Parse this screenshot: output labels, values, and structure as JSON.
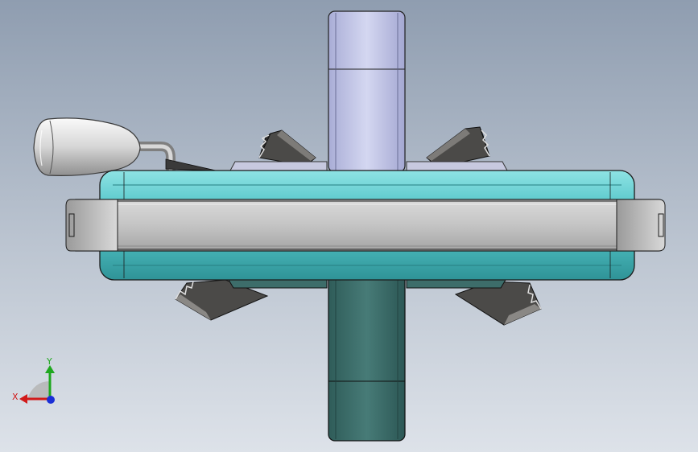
{
  "view": {
    "background_top": "#8f9db0",
    "background_bottom": "#dde2e9"
  },
  "model": {
    "upper_post_color": "#c3c6e6",
    "lower_post_color": "#3b6b68",
    "ring_color": "#5cc9cc",
    "band_color": "#bdbdbd",
    "jaw_color": "#4b4a48",
    "handle_color": "#e6e6e6"
  },
  "triad": {
    "x_label": "X",
    "y_label": "Y",
    "x_color": "#d11a1a",
    "y_color": "#1fa81f",
    "z_color": "#1a2fd6"
  }
}
